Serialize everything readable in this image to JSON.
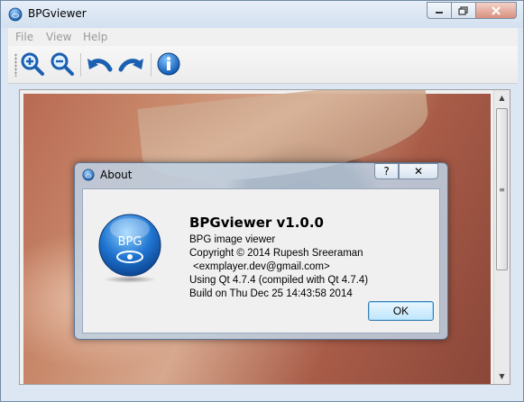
{
  "window": {
    "title": "BPGviewer",
    "minimize_icon": "minimize-icon",
    "maximize_icon": "maximize-icon",
    "close_icon": "close-icon"
  },
  "menubar": {
    "items": [
      {
        "label": "File"
      },
      {
        "label": "View"
      },
      {
        "label": "Help"
      }
    ]
  },
  "toolbar": {
    "buttons": [
      {
        "icon": "zoom-in-icon"
      },
      {
        "icon": "zoom-out-icon"
      },
      {
        "icon": "rotate-left-icon"
      },
      {
        "icon": "rotate-right-icon"
      },
      {
        "icon": "info-icon"
      }
    ]
  },
  "about_dialog": {
    "title": "About",
    "help_label": "?",
    "close_label": "✕",
    "logo_text": "BPG",
    "heading": "BPGviewer v1.0.0",
    "lines": [
      "BPG image viewer",
      "Copyright © 2014 Rupesh Sreeraman",
      "<exmplayer.dev@gmail.com>",
      "Using Qt 4.7.4 (compiled with Qt 4.7.4)",
      "Build on Thu Dec 25 14:43:58 2014"
    ],
    "ok_label": "OK"
  },
  "colors": {
    "accent": "#1a6fc9",
    "ok_border": "#3c7fb1"
  }
}
